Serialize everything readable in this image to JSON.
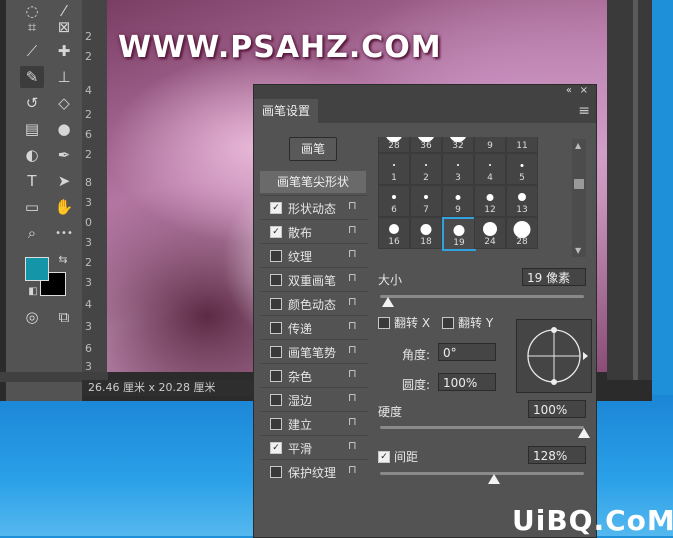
{
  "watermark_top": "WWW.PSAHZ.COM",
  "watermark_bottom": "UiBQ.CoM",
  "colors": {
    "foreground": "#1596a8",
    "background": "#000000",
    "accent": "#33a0e0"
  },
  "toolbar": {
    "tools": [
      "lasso-icon",
      "wand-icon",
      "crop-icon",
      "frame-icon",
      "eyedropper-icon",
      "heal-icon",
      "brush-icon",
      "stamp-icon",
      "history-brush-icon",
      "eraser-icon",
      "gradient-icon",
      "blur-icon",
      "dodge-icon",
      "pen-icon",
      "type-icon",
      "path-select-icon",
      "shape-icon",
      "hand-icon",
      "zoom-icon",
      "more-icon"
    ],
    "glyphs": {
      "type": "T",
      "more": "•••"
    }
  },
  "ruler": {
    "marks": [
      "2",
      "2",
      "4",
      "2",
      "6",
      "2",
      "8",
      "3",
      "0",
      "3",
      "2",
      "3",
      "4",
      "3",
      "6",
      "3",
      "8"
    ]
  },
  "status": {
    "size_text": "26.46 厘米 x 20.28 厘米"
  },
  "panel": {
    "title": "画笔设置",
    "brush_button": "画笔",
    "options_header": "画笔笔尖形状",
    "options": [
      {
        "label": "形状动态",
        "checked": true
      },
      {
        "label": "散布",
        "checked": true
      },
      {
        "label": "纹理",
        "checked": false
      },
      {
        "label": "双重画笔",
        "checked": false
      },
      {
        "label": "颜色动态",
        "checked": false
      },
      {
        "label": "传递",
        "checked": false
      },
      {
        "label": "画笔笔势",
        "checked": false
      },
      {
        "label": "杂色",
        "checked": false
      },
      {
        "label": "湿边",
        "checked": false
      },
      {
        "label": "建立",
        "checked": false
      },
      {
        "label": "平滑",
        "checked": true
      },
      {
        "label": "保护纹理",
        "checked": false
      }
    ],
    "tips": [
      [
        "28",
        "36",
        "32",
        "9",
        "11"
      ],
      [
        "1",
        "2",
        "3",
        "4",
        "5"
      ],
      [
        "6",
        "7",
        "9",
        "12",
        "13"
      ],
      [
        "16",
        "18",
        "19",
        "24",
        "28"
      ]
    ],
    "selected_tip": "19",
    "size_label": "大小",
    "size_value": "19 像素",
    "size_fraction": 0.04,
    "flip_x": "翻转 X",
    "flip_y": "翻转 Y",
    "angle_label": "角度:",
    "angle_value": "0°",
    "roundness_label": "圆度:",
    "roundness_value": "100%",
    "hardness_label": "硬度",
    "hardness_value": "100%",
    "hardness_fraction": 1.0,
    "spacing_label": "间距",
    "spacing_checked": true,
    "spacing_value": "128%",
    "spacing_fraction": 0.56,
    "collapse_glyph": "«",
    "close_glyph": "×",
    "menu_glyph": "≡",
    "lock_glyph": "🔒"
  }
}
